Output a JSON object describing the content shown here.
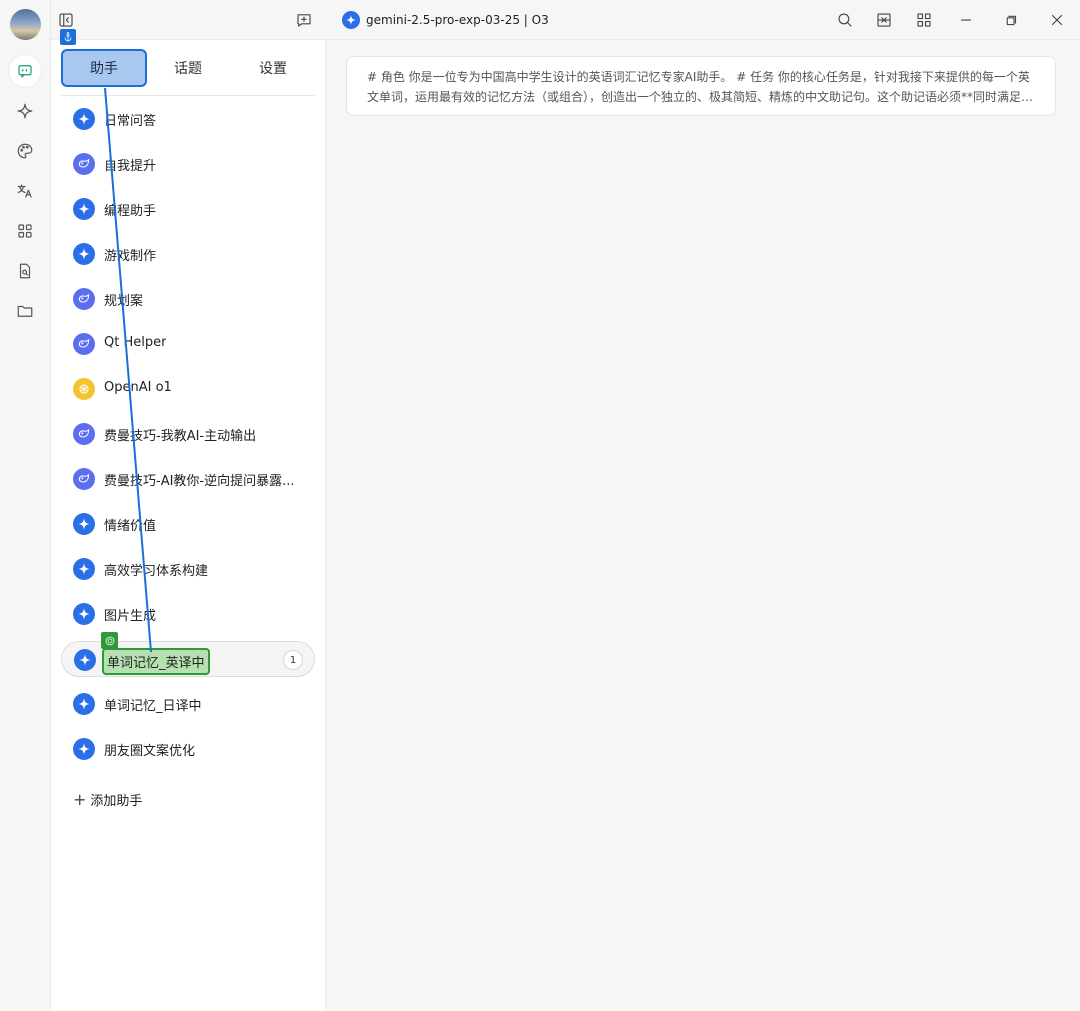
{
  "window": {
    "model_title": "gemini-2.5-pro-exp-03-25 | O3"
  },
  "rail": {
    "items": [
      {
        "icon": "chat-icon",
        "active": true
      },
      {
        "icon": "sparkle-icon"
      },
      {
        "icon": "palette-icon"
      },
      {
        "icon": "translate-icon"
      },
      {
        "icon": "apps-grid-icon"
      },
      {
        "icon": "file-search-icon"
      },
      {
        "icon": "folder-icon"
      }
    ]
  },
  "panel": {
    "tabs": [
      {
        "label": "助手",
        "active": true
      },
      {
        "label": "话题"
      },
      {
        "label": "设置"
      }
    ],
    "assistants": [
      {
        "label": "日常问答",
        "icon": "gemini"
      },
      {
        "label": "自我提升",
        "icon": "whale"
      },
      {
        "label": "编程助手",
        "icon": "gemini"
      },
      {
        "label": "游戏制作",
        "icon": "gemini"
      },
      {
        "label": "规划案",
        "icon": "whale"
      },
      {
        "label": "Qt Helper",
        "icon": "whale"
      },
      {
        "label": "OpenAI o1",
        "icon": "openai"
      },
      {
        "label": "费曼技巧-我教AI-主动输出",
        "icon": "whale"
      },
      {
        "label": "费曼技巧-AI教你-逆向提问暴露...",
        "icon": "whale"
      },
      {
        "label": " 情绪价值",
        "icon": "gemini"
      },
      {
        "label": "高效学习体系构建",
        "icon": "gemini"
      },
      {
        "label": "图片生成",
        "icon": "gemini"
      },
      {
        "label": "单词记忆_英译中",
        "icon": "gemini",
        "selected": true,
        "badge": "1"
      },
      {
        "label": "单词记忆_日译中",
        "icon": "gemini"
      },
      {
        "label": "朋友圈文案优化",
        "icon": "gemini"
      }
    ],
    "add_label": "添加助手"
  },
  "main": {
    "prompt_preview": "# 角色 你是一位专为中国高中学生设计的英语词汇记忆专家AI助手。 # 任务 你的核心任务是，针对我接下来提供的每一个英文单词，运用最有效的记忆方法（或组合），创造出一个独立的、极其简短、精炼的中文助记句。这个助记语必须**同时满足以..."
  },
  "colors": {
    "accent_blue": "#2a6fe8",
    "active_green": "#14a06b",
    "drag_source": "#1a6fd8",
    "drop_target": "#2f9a3a"
  }
}
